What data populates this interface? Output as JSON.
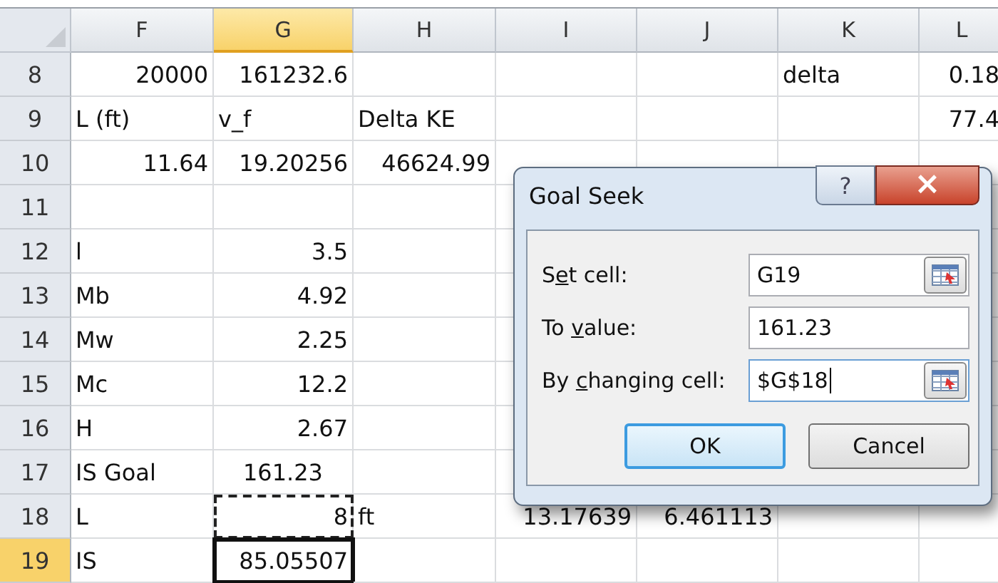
{
  "columns": [
    {
      "label": "F",
      "selected": false
    },
    {
      "label": "G",
      "selected": true
    },
    {
      "label": "H",
      "selected": false
    },
    {
      "label": "I",
      "selected": false
    },
    {
      "label": "J",
      "selected": false
    },
    {
      "label": "K",
      "selected": false
    },
    {
      "label": "L",
      "selected": false
    }
  ],
  "rows": [
    {
      "number": "8",
      "selected": false,
      "cells": {
        "F": {
          "text": "20000",
          "kind": "number"
        },
        "G": {
          "text": "161232.6",
          "kind": "number"
        },
        "K": {
          "text": "delta",
          "kind": "text"
        },
        "L": {
          "text": "0.18",
          "kind": "number"
        }
      }
    },
    {
      "number": "9",
      "selected": false,
      "cells": {
        "F": {
          "text": "L (ft)",
          "kind": "text"
        },
        "G": {
          "text": "v_f",
          "kind": "text"
        },
        "H": {
          "text": "Delta KE",
          "kind": "text"
        },
        "L": {
          "text": "77.4",
          "kind": "number"
        }
      }
    },
    {
      "number": "10",
      "selected": false,
      "cells": {
        "F": {
          "text": "11.64",
          "kind": "number"
        },
        "G": {
          "text": "19.20256",
          "kind": "number"
        },
        "H": {
          "text": "46624.99",
          "kind": "number"
        }
      }
    },
    {
      "number": "11",
      "selected": false,
      "cells": {}
    },
    {
      "number": "12",
      "selected": false,
      "cells": {
        "F": {
          "text": "l",
          "kind": "text"
        },
        "G": {
          "text": "3.5",
          "kind": "number"
        }
      }
    },
    {
      "number": "13",
      "selected": false,
      "cells": {
        "F": {
          "text": "Mb",
          "kind": "text"
        },
        "G": {
          "text": "4.92",
          "kind": "number"
        }
      }
    },
    {
      "number": "14",
      "selected": false,
      "cells": {
        "F": {
          "text": "Mw",
          "kind": "text"
        },
        "G": {
          "text": "2.25",
          "kind": "number"
        }
      }
    },
    {
      "number": "15",
      "selected": false,
      "cells": {
        "F": {
          "text": "Mc",
          "kind": "text"
        },
        "G": {
          "text": "12.2",
          "kind": "number"
        }
      }
    },
    {
      "number": "16",
      "selected": false,
      "cells": {
        "F": {
          "text": "H",
          "kind": "text"
        },
        "G": {
          "text": "2.67",
          "kind": "number"
        }
      }
    },
    {
      "number": "17",
      "selected": false,
      "cells": {
        "F": {
          "text": "IS Goal",
          "kind": "text"
        },
        "G": {
          "text": "161.23",
          "kind": "centered"
        }
      }
    },
    {
      "number": "18",
      "selected": false,
      "cells": {
        "F": {
          "text": "L",
          "kind": "text"
        },
        "G": {
          "text": "8",
          "kind": "number",
          "marquee": true
        },
        "H": {
          "text": "ft",
          "kind": "text"
        },
        "I": {
          "text": "13.17639",
          "kind": "number"
        },
        "J": {
          "text": "6.461113",
          "kind": "number"
        }
      }
    },
    {
      "number": "19",
      "selected": true,
      "cells": {
        "F": {
          "text": "IS",
          "kind": "text"
        },
        "G": {
          "text": "85.05507",
          "kind": "number",
          "active": true
        }
      }
    }
  ],
  "dialog": {
    "title": "Goal Seek",
    "help": "?",
    "close": "×",
    "fields": [
      {
        "label_before": "S",
        "access_key": "e",
        "label_after": "t cell:",
        "value": "G19",
        "picker": true,
        "focused": false
      },
      {
        "label_before": "To ",
        "access_key": "v",
        "label_after": "alue:",
        "value": "161.23",
        "picker": false,
        "focused": false
      },
      {
        "label_before": "By ",
        "access_key": "c",
        "label_after": "hanging cell:",
        "value": "$G$18",
        "picker": true,
        "focused": true
      }
    ],
    "buttons": [
      {
        "label": "OK",
        "default": true
      },
      {
        "label": "Cancel",
        "default": false
      }
    ]
  }
}
